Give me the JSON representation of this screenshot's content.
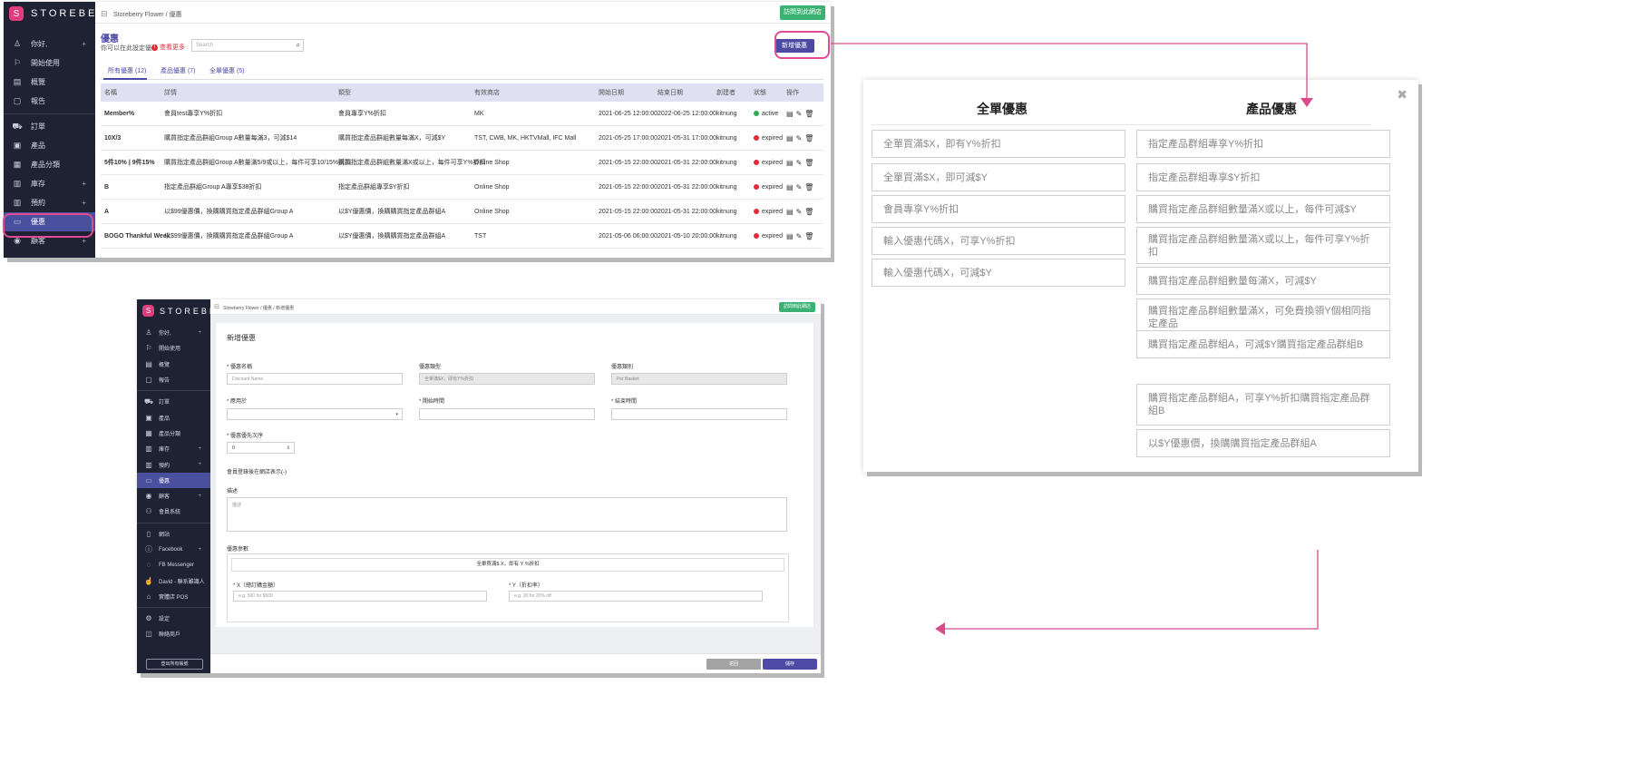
{
  "brand": {
    "name": "STOREBERRY",
    "mark": "S"
  },
  "colors": {
    "sidebar": "#1e2233",
    "active": "#4a4f9e",
    "accent_pink": "#e24a95",
    "green": "#3bb273",
    "purple": "#4d4aa5"
  },
  "shot_a": {
    "breadcrumb": "Storeberry Flower  /  優惠",
    "visit_store_button": "訪問到此網店",
    "sidebar": [
      {
        "icon": "person-icon",
        "label": "你好,",
        "plus": "+"
      },
      {
        "icon": "flag-icon",
        "label": "開始使用"
      },
      {
        "icon": "chart-icon",
        "label": "概覽"
      },
      {
        "icon": "doc-icon",
        "label": "報告"
      },
      {
        "icon": "cart-icon",
        "label": "訂單"
      },
      {
        "icon": "box-icon",
        "label": "產品"
      },
      {
        "icon": "grid-icon",
        "label": "產品分類"
      },
      {
        "icon": "calendar-icon",
        "label": "庫存",
        "plus": "+"
      },
      {
        "icon": "calendar-icon",
        "label": "預約",
        "plus": "+"
      },
      {
        "icon": "ticket-icon",
        "label": "優惠"
      },
      {
        "icon": "user-circle-icon",
        "label": "顧客",
        "plus": "+"
      }
    ],
    "page_title": "優惠",
    "page_subtitle": "你可以在此設定優惠",
    "learn_more": "查看更多",
    "search_placeholder": "Search",
    "add_button": "新增優惠",
    "tabs": [
      "所有優惠 (12)",
      "產品優惠 (7)",
      "全單優惠 (5)"
    ],
    "columns": [
      "名稱",
      "詳情",
      "類型",
      "有效商店",
      "開始日期",
      "結束日期",
      "創建者",
      "狀態",
      "操作"
    ],
    "rows": [
      {
        "name": "Member%",
        "detail": "會員test專享Y%折扣",
        "type": "會員專享Y%折扣",
        "store": "MK",
        "start": "2021-06-25 12:00:00",
        "end": "2022-06-25 12:00:00",
        "creator": "kitnung",
        "status": "active",
        "status_color": "#2eaa4f"
      },
      {
        "name": "10X/3",
        "detail": "購買指定產品群組Group A數量每滿3，可減$14",
        "type": "購買指定產品群組數量每滿X，可減$Y",
        "store": "TST, CWB, MK, HKTVMall, IFC Mall",
        "start": "2021-05-25 17:00:00",
        "end": "2021-05-31 17:00:00",
        "creator": "kitnung",
        "status": "expired",
        "status_color": "#e5293a"
      },
      {
        "name": "5件10% | 9件15%",
        "detail": "購買指定產品群組Group A數量滿5/9或以上，每件可享10/15%折扣",
        "type": "購買指定產品群組數量滿X或以上，每件可享Y%折扣",
        "store": "Online Shop",
        "start": "2021-05-15 22:00:00",
        "end": "2021-05-31 22:00:00",
        "creator": "kitnung",
        "status": "expired",
        "status_color": "#e5293a"
      },
      {
        "name": "B",
        "detail": "指定產品群組Group A專享$38折扣",
        "type": "指定產品群組專享$Y折扣",
        "store": "Online Shop",
        "start": "2021-05-15 22:00:00",
        "end": "2021-05-31 22:00:00",
        "creator": "kitnung",
        "status": "expired",
        "status_color": "#e5293a"
      },
      {
        "name": "A",
        "detail": "以$99優惠價，換購購買指定產品群組Group A",
        "type": "以$Y優惠價，換購購買指定產品群組A",
        "store": "Online Shop",
        "start": "2021-05-15 22:00:00",
        "end": "2021-05-31 22:00:00",
        "creator": "kitnung",
        "status": "expired",
        "status_color": "#e5293a"
      },
      {
        "name": "BOGO Thankful Week",
        "detail": "以$99優惠價，換購購買指定產品群組Group A",
        "type": "以$Y優惠價，換購購買指定產品群組A",
        "store": "TST",
        "start": "2021-05-06 06:00:00",
        "end": "2021-05-10 20:00:00",
        "creator": "kitnung",
        "status": "expired",
        "status_color": "#e5293a"
      }
    ]
  },
  "shot_b": {
    "close": "✖",
    "left_title": "全單優惠",
    "right_title": "產品優惠",
    "left_options": [
      "全單買滿$X，即有Y%折扣",
      "全單買滿$X，即可減$Y",
      "會員專享Y%折扣",
      "輸入優惠代碼X，可享Y%折扣",
      "輸入優惠代碼X，可減$Y"
    ],
    "right_options": [
      "指定產品群組專享Y%折扣",
      "指定產品群組專享$Y折扣",
      "購買指定產品群組數量滿X或以上，每件可減$Y",
      "購買指定產品群組數量滿X或以上，每件可享Y%折扣",
      "購買指定產品群組數量每滿X，可減$Y",
      "購買指定產品群組數量滿X，可免費換領Y個相同指定產品",
      "購買指定產品群組A，可減$Y購買指定產品群組B",
      "購買指定產品群組A，可享Y%折扣購買指定產品群組B",
      "以$Y優惠價，換購購買指定產品群組A"
    ]
  },
  "shot_c": {
    "breadcrumb": "Storeberry Flower  /  優惠  /  新增優惠",
    "visit_store_button": "訪問到此網店",
    "sidebar": [
      {
        "icon": "person-icon",
        "label": "你好,",
        "plus": "+"
      },
      {
        "icon": "flag-icon",
        "label": "開始使用"
      },
      {
        "icon": "chart-icon",
        "label": "概覽"
      },
      {
        "icon": "doc-icon",
        "label": "報告"
      },
      {
        "icon": "cart-icon",
        "label": "訂單"
      },
      {
        "icon": "box-icon",
        "label": "產品"
      },
      {
        "icon": "grid-icon",
        "label": "產品分類"
      },
      {
        "icon": "calendar-icon",
        "label": "庫存",
        "plus": "+"
      },
      {
        "icon": "calendar-icon",
        "label": "預約",
        "plus": "+"
      },
      {
        "icon": "ticket-icon",
        "label": "優惠"
      },
      {
        "icon": "user-circle-icon",
        "label": "顧客",
        "plus": "+"
      },
      {
        "icon": "users-icon",
        "label": "會員系統"
      },
      {
        "icon": "book-icon",
        "label": "網站"
      },
      {
        "icon": "info-icon",
        "label": "Facebook",
        "plus": "+"
      },
      {
        "icon": "chat-icon",
        "label": "FB Messenger"
      },
      {
        "icon": "thumb-icon",
        "label": "David - 聯系雖識人"
      },
      {
        "icon": "home-icon",
        "label": "實體店 POS"
      },
      {
        "icon": "gear-icon",
        "label": "設定"
      },
      {
        "icon": "tag-icon",
        "label": "聯絡商戶"
      }
    ],
    "logout": "登出所有帳號",
    "form_title": "新增優惠",
    "fields": {
      "name_label": "* 優惠名稱",
      "name_placeholder": "Discount Name",
      "type_label": "優惠類型",
      "type_value": "全單滿$X，即有Y%折扣",
      "scope_label": "優惠類別",
      "scope_value": "Per Basket",
      "apply_label": "* 應用於",
      "start_label": "* 開始時間",
      "end_label": "* 結束時間",
      "priority_label": "* 優惠優先次序",
      "priority_value": "0",
      "member_note": "會員登錄後在網店表示(-)",
      "desc_label": "描述",
      "desc_placeholder": "描述",
      "params_label": "優惠參數",
      "params_banner": "全單買滿$ X，即有 Y %折扣",
      "x_label": "* X（總訂購金額）",
      "x_placeholder": "e.g. 500 for $500",
      "y_label": "* Y（折扣率）",
      "y_placeholder": "e.g. 20 for 20% off"
    },
    "back_button": "返回",
    "save_button": "儲存"
  }
}
